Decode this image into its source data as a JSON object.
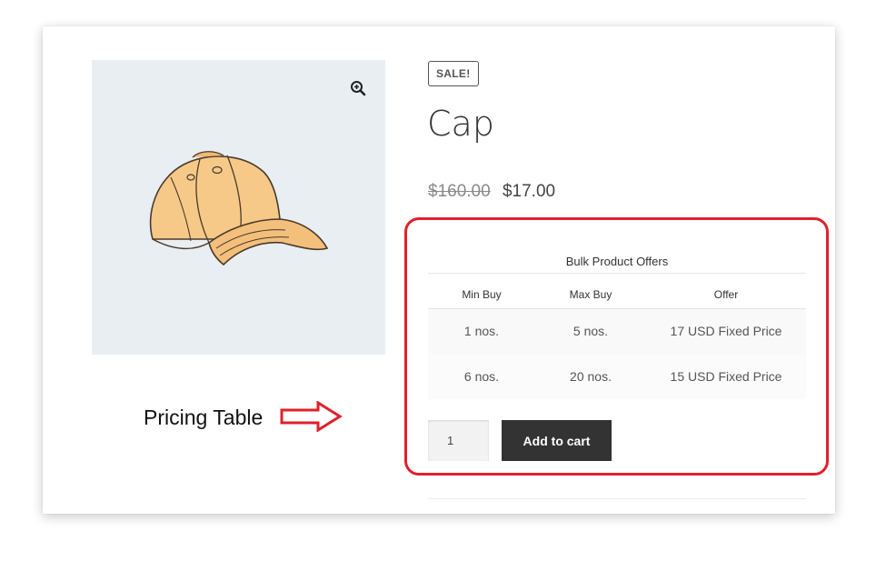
{
  "product": {
    "sale_badge": "SALE!",
    "title": "Cap",
    "price_old": "$160.00",
    "price_new": "$17.00",
    "image_icon": "zoom-in-icon"
  },
  "offers": {
    "title": "Bulk Product Offers",
    "headers": [
      "Min Buy",
      "Max Buy",
      "Offer"
    ],
    "rows": [
      [
        "1 nos.",
        "5 nos.",
        "17 USD Fixed Price"
      ],
      [
        "6 nos.",
        "20 nos.",
        "15 USD Fixed Price"
      ]
    ]
  },
  "cart": {
    "quantity": "1",
    "add_label": "Add to cart"
  },
  "annotation": {
    "label": "Pricing Table",
    "icon": "right-arrow-icon"
  },
  "colors": {
    "highlight": "#e0202b",
    "button": "#333333",
    "image_bg": "#e9eef2"
  }
}
